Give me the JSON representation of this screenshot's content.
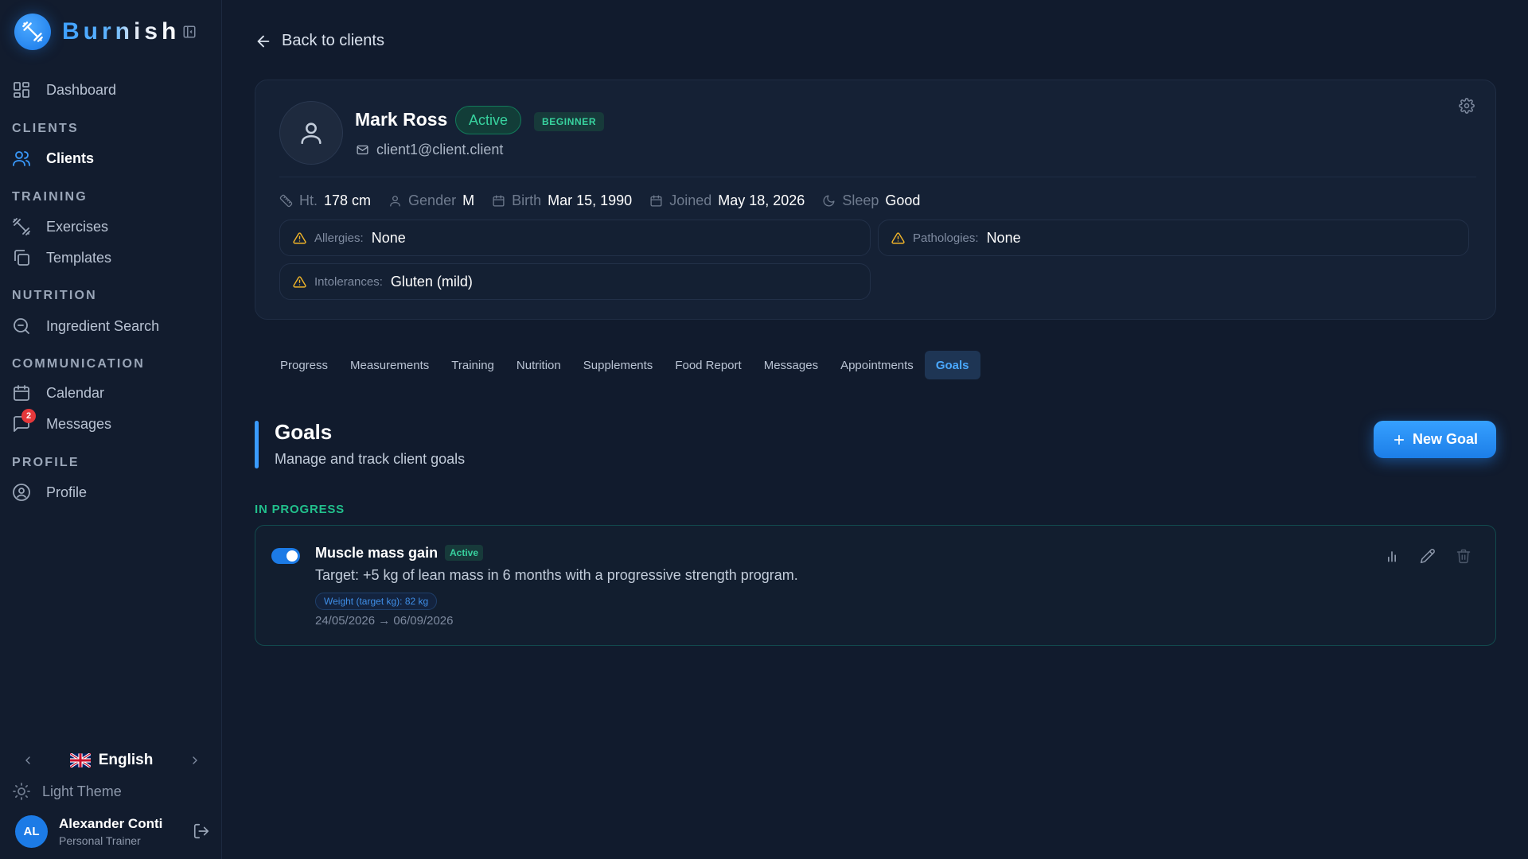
{
  "app": {
    "name": "Burnish"
  },
  "sidebar": {
    "dashboard": "Dashboard",
    "sections": {
      "clients": "CLIENTS",
      "training": "TRAINING",
      "nutrition": "NUTRITION",
      "communication": "COMMUNICATION",
      "profile": "PROFILE"
    },
    "items": {
      "clients": "Clients",
      "exercises": "Exercises",
      "templates": "Templates",
      "ingredient_search": "Ingredient Search",
      "calendar": "Calendar",
      "messages": "Messages",
      "profile": "Profile"
    },
    "messages_badge": "2",
    "language": "English",
    "theme_toggle": "Light Theme",
    "user": {
      "initials": "AL",
      "name": "Alexander Conti",
      "role": "Personal Trainer"
    }
  },
  "main": {
    "back_label": "Back to clients",
    "client": {
      "name": "Mark Ross",
      "status": "Active",
      "level": "BEGINNER",
      "email": "client1@client.client",
      "stats": [
        {
          "label": "Ht.",
          "value": "178 cm",
          "icon": "ruler-icon"
        },
        {
          "label": "Gender",
          "value": "M",
          "icon": "person-icon"
        },
        {
          "label": "Birth",
          "value": "Mar 15, 1990",
          "icon": "calendar-icon"
        },
        {
          "label": "Joined",
          "value": "May 18, 2026",
          "icon": "calendar-icon"
        },
        {
          "label": "Sleep",
          "value": "Good",
          "icon": "moon-icon"
        }
      ],
      "allergies_label": "Allergies:",
      "allergies_value": "None",
      "pathologies_label": "Pathologies:",
      "pathologies_value": "None",
      "intolerances_label": "Intolerances:",
      "intolerances_value": "Gluten (mild)"
    },
    "tabs": [
      "Progress",
      "Measurements",
      "Training",
      "Nutrition",
      "Supplements",
      "Food Report",
      "Messages",
      "Appointments",
      "Goals"
    ],
    "active_tab": "Goals",
    "goals": {
      "title": "Goals",
      "subtitle": "Manage and track client goals",
      "new_goal_label": "New Goal",
      "section_label": "IN PROGRESS",
      "items": [
        {
          "title": "Muscle mass gain",
          "status": "Active",
          "description": "Target: +5 kg of lean mass in 6 months with a progressive strength program.",
          "tag": "Weight (target kg): 82 kg",
          "dates": "24/05/2026 → 06/09/2026",
          "enabled": true
        }
      ]
    }
  },
  "colors": {
    "background": "#111b2d",
    "accent": "#2b8cf5",
    "success": "#38d39f",
    "warning": "#f0b429",
    "danger": "#e5383b"
  }
}
